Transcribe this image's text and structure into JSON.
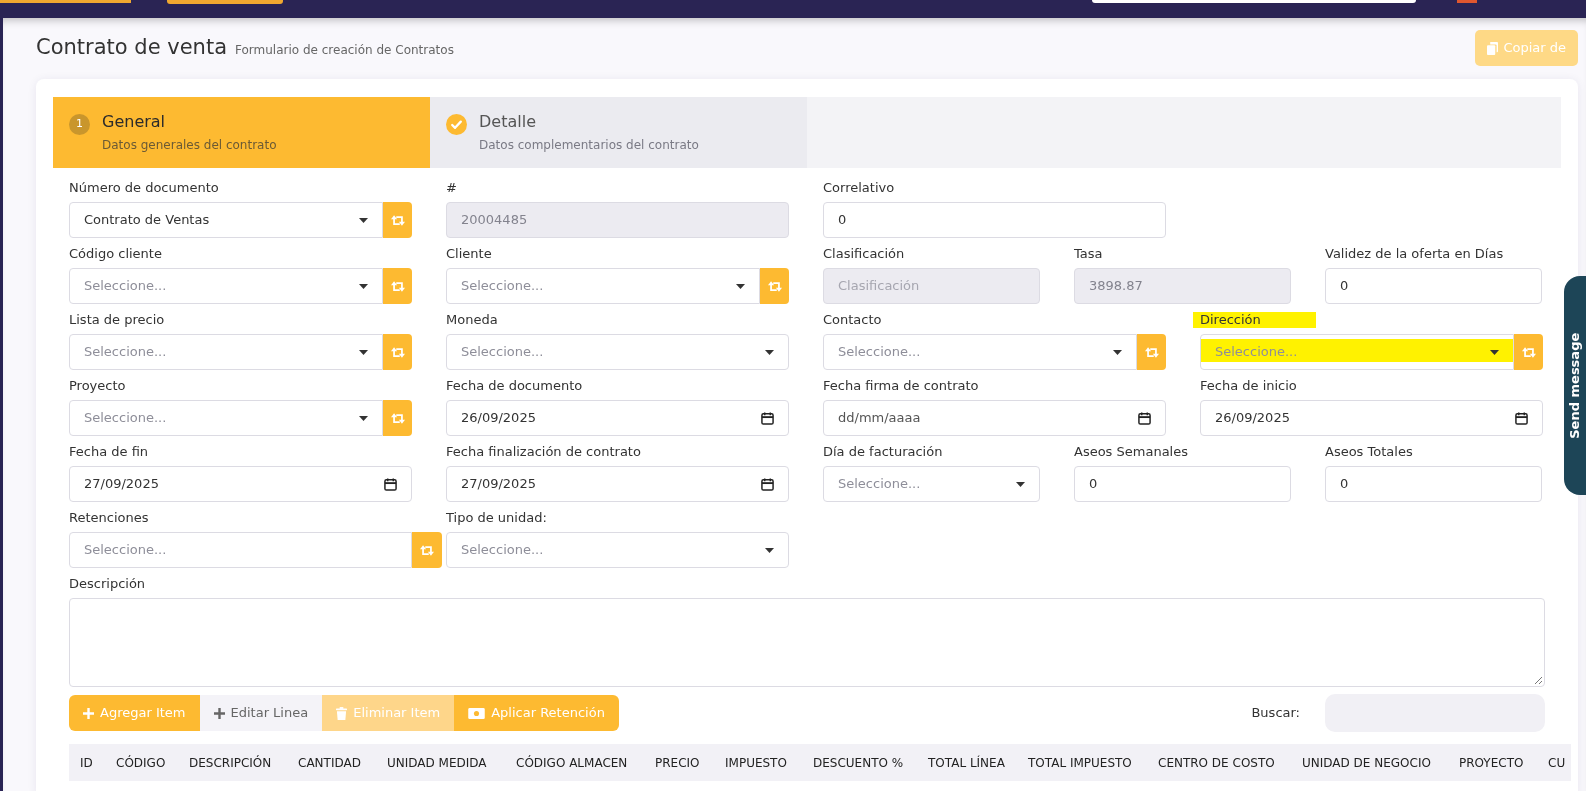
{
  "page": {
    "title": "Contrato de venta",
    "subtitle": "Formulario de creación de Contratos",
    "copy_button": {
      "label": "Copiar de",
      "disabled": true
    }
  },
  "steps": [
    {
      "number": "1",
      "title": "General",
      "subtitle": "Datos generales del contrato",
      "selected": true,
      "completed": false
    },
    {
      "title": "Detalle",
      "subtitle": "Datos complementarios del contrato",
      "selected": false,
      "completed": true
    }
  ],
  "form": {
    "rows": [
      [
        {
          "label": "Número de documento",
          "kind": "select",
          "value": "Contrato de Ventas",
          "disabled": false,
          "refresh_button": true,
          "highlighted": false
        },
        {
          "label": "#",
          "kind": "text",
          "value": "20004485",
          "disabled": true,
          "refresh_button": false,
          "highlighted": false
        },
        {
          "label": "Correlativo",
          "kind": "text",
          "value": "0",
          "disabled": false,
          "refresh_button": false,
          "highlighted": false
        }
      ],
      [
        {
          "label": "Código cliente",
          "kind": "select",
          "placeholder": "Seleccione...",
          "disabled": false,
          "refresh_button": true,
          "highlighted": false
        },
        {
          "label": "Cliente",
          "kind": "select",
          "placeholder": "Seleccione...",
          "disabled": false,
          "refresh_button": true,
          "highlighted": false
        },
        {
          "label": "Clasificación",
          "kind": "text",
          "placeholder": "Clasificación",
          "disabled": true,
          "refresh_button": false,
          "highlighted": false
        },
        {
          "label": "Tasa",
          "kind": "text",
          "value": "3898.87",
          "disabled": true,
          "refresh_button": false,
          "highlighted": false
        },
        {
          "label": "Validez de la oferta en Días",
          "kind": "text",
          "value": "0",
          "disabled": false,
          "refresh_button": false,
          "highlighted": false
        }
      ],
      [
        {
          "label": "Lista de precio",
          "kind": "select",
          "placeholder": "Seleccione...",
          "disabled": false,
          "refresh_button": true,
          "highlighted": false
        },
        {
          "label": "Moneda",
          "kind": "select",
          "placeholder": "Seleccione...",
          "disabled": false,
          "refresh_button": false,
          "highlighted": false
        },
        {
          "label": "Contacto",
          "kind": "select",
          "placeholder": "Seleccione...",
          "disabled": false,
          "refresh_button": true,
          "highlighted": false
        },
        {
          "label": "Dirección",
          "kind": "select",
          "placeholder": "Seleccione...",
          "disabled": false,
          "refresh_button": true,
          "highlighted": true
        }
      ],
      [
        {
          "label": "Proyecto",
          "kind": "select",
          "placeholder": "Seleccione...",
          "disabled": false,
          "refresh_button": true,
          "highlighted": false
        },
        {
          "label": "Fecha de documento",
          "kind": "date",
          "value": "26/09/2025",
          "disabled": false,
          "refresh_button": false,
          "highlighted": false
        },
        {
          "label": "Fecha firma de contrato",
          "kind": "date",
          "placeholder": "dd/mm/aaaa",
          "disabled": false,
          "refresh_button": false,
          "highlighted": false
        },
        {
          "label": "Fecha de inicio",
          "kind": "date",
          "value": "26/09/2025",
          "disabled": false,
          "refresh_button": false,
          "highlighted": false
        }
      ],
      [
        {
          "label": "Fecha de fin",
          "kind": "date",
          "value": "27/09/2025",
          "disabled": false,
          "refresh_button": false,
          "highlighted": false
        },
        {
          "label": "Fecha finalización de contrato",
          "kind": "date",
          "value": "27/09/2025",
          "disabled": false,
          "refresh_button": false,
          "highlighted": false
        },
        {
          "label": "Día de facturación",
          "kind": "select",
          "placeholder": "Seleccione...",
          "disabled": false,
          "refresh_button": false,
          "highlighted": false
        },
        {
          "label": "Aseos Semanales",
          "kind": "text",
          "value": "0",
          "disabled": false,
          "refresh_button": false,
          "highlighted": false
        },
        {
          "label": "Aseos Totales",
          "kind": "text",
          "value": "0",
          "disabled": false,
          "refresh_button": false,
          "highlighted": false
        }
      ],
      [
        {
          "label": "Retenciones",
          "kind": "multiselect",
          "placeholder": "Seleccione...",
          "disabled": false,
          "refresh_button": true,
          "highlighted": false
        },
        {
          "label": "Tipo de unidad:",
          "kind": "select",
          "placeholder": "Seleccione...",
          "disabled": false,
          "refresh_button": false,
          "highlighted": false
        }
      ]
    ],
    "description": {
      "label": "Descripción"
    }
  },
  "toolbar": {
    "buttons": [
      {
        "label": "Agregar Item",
        "kind": "add",
        "disabled": false
      },
      {
        "label": "Editar Linea",
        "kind": "edit",
        "disabled": false
      },
      {
        "label": "Eliminar Item",
        "kind": "delete",
        "disabled": true
      },
      {
        "label": "Aplicar Retención",
        "kind": "apply",
        "disabled": false
      }
    ],
    "search": {
      "label": "Buscar:"
    }
  },
  "table": {
    "columns": [
      "ID",
      "CÓDIGO",
      "DESCRIPCIÓN",
      "CANTIDAD",
      "UNIDAD MEDIDA",
      "CÓDIGO ALMACEN",
      "PRECIO",
      "IMPUESTO",
      "DESCUENTO %",
      "TOTAL LÍNEA",
      "TOTAL IMPUESTO",
      "CENTRO DE COSTO",
      "UNIDAD DE NEGOCIO",
      "PROYECTO",
      "CU"
    ]
  },
  "chat_tab": {
    "label": "Send message"
  }
}
